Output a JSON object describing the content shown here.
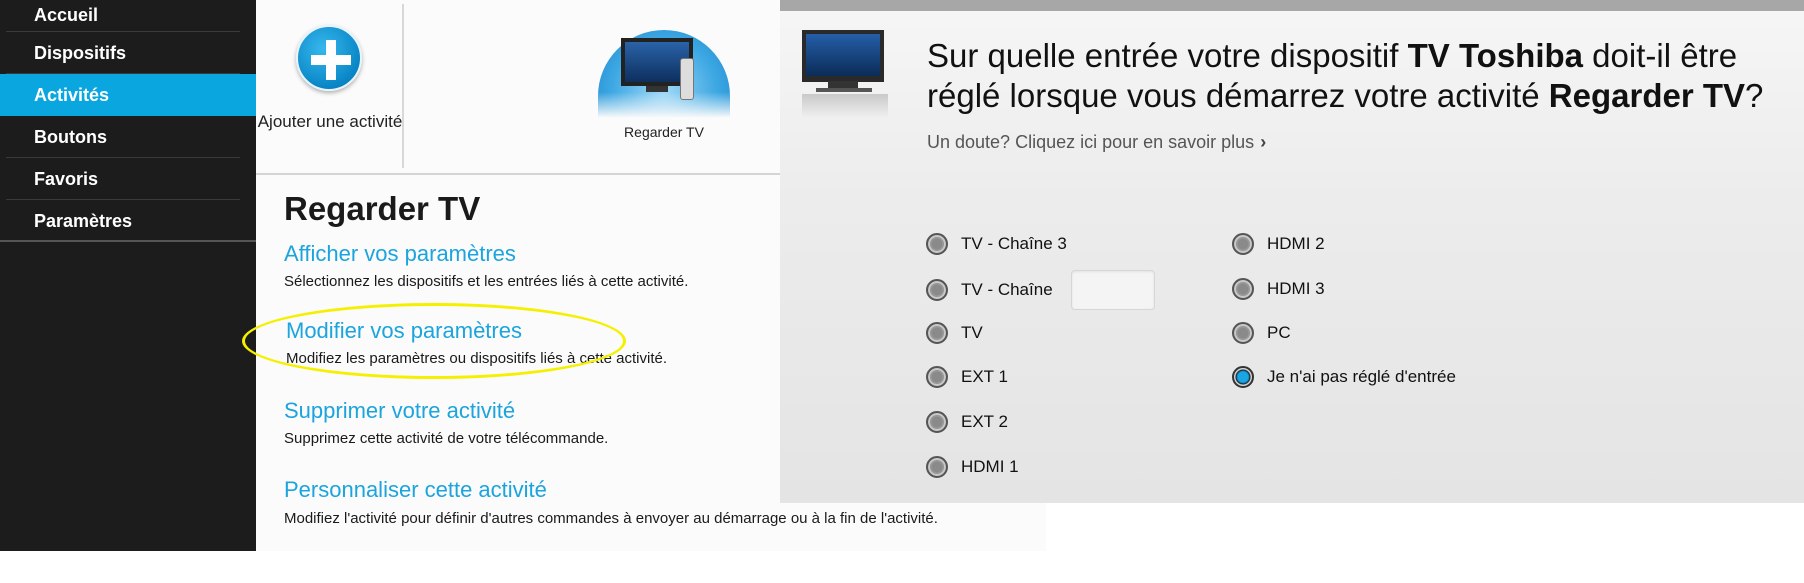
{
  "sidebar": {
    "items": [
      {
        "label": "Accueil",
        "active": false
      },
      {
        "label": "Dispositifs",
        "active": false
      },
      {
        "label": "Activités",
        "active": true
      },
      {
        "label": "Boutons",
        "active": false
      },
      {
        "label": "Favoris",
        "active": false
      },
      {
        "label": "Paramètres",
        "active": false
      }
    ]
  },
  "activity_panel": {
    "add_label": "Ajouter une activité",
    "add_icon": "plus-icon",
    "tv_tile_label": "Regarder TV",
    "tv_icon": "tv-icon",
    "title": "Regarder TV",
    "options": [
      {
        "link": "Afficher vos paramètres",
        "desc": "Sélectionnez les dispositifs et les entrées liés à cette activité."
      },
      {
        "link": "Modifier vos paramètres",
        "desc": "Modifiez les paramètres ou dispositifs liés à cette activité."
      },
      {
        "link": "Supprimer votre activité",
        "desc": "Supprimez cette activité de votre télécommande."
      },
      {
        "link": "Personnaliser cette activité",
        "desc": "Modifiez l'activité pour définir d'autres commandes à envoyer au démarrage ou à la fin de l'activité."
      }
    ]
  },
  "input_panel": {
    "question_parts": {
      "p1": "Sur quelle entrée votre dispositif ",
      "device": "TV Toshiba",
      "p2": " doit-il être réglé lorsque vous démarrez votre activité ",
      "activity": "Regarder TV",
      "p3": "?"
    },
    "help_link": "Un doute? Cliquez ici pour en savoir plus",
    "chevron_icon": "chevron-right-icon",
    "left_options": [
      "TV - Chaîne 3",
      "TV - Chaîne",
      "TV",
      "EXT 1",
      "EXT 2",
      "HDMI 1"
    ],
    "right_options": [
      "HDMI 2",
      "HDMI 3",
      "PC",
      "Je n'ai pas réglé d'entrée"
    ],
    "selected": "Je n'ai pas réglé d'entrée",
    "channel_value": ""
  },
  "colors": {
    "sidebar_bg": "#1c1c1c",
    "accent": "#0aa6e0",
    "link": "#1ba4dd",
    "highlight_ellipse": "#f5f000"
  }
}
